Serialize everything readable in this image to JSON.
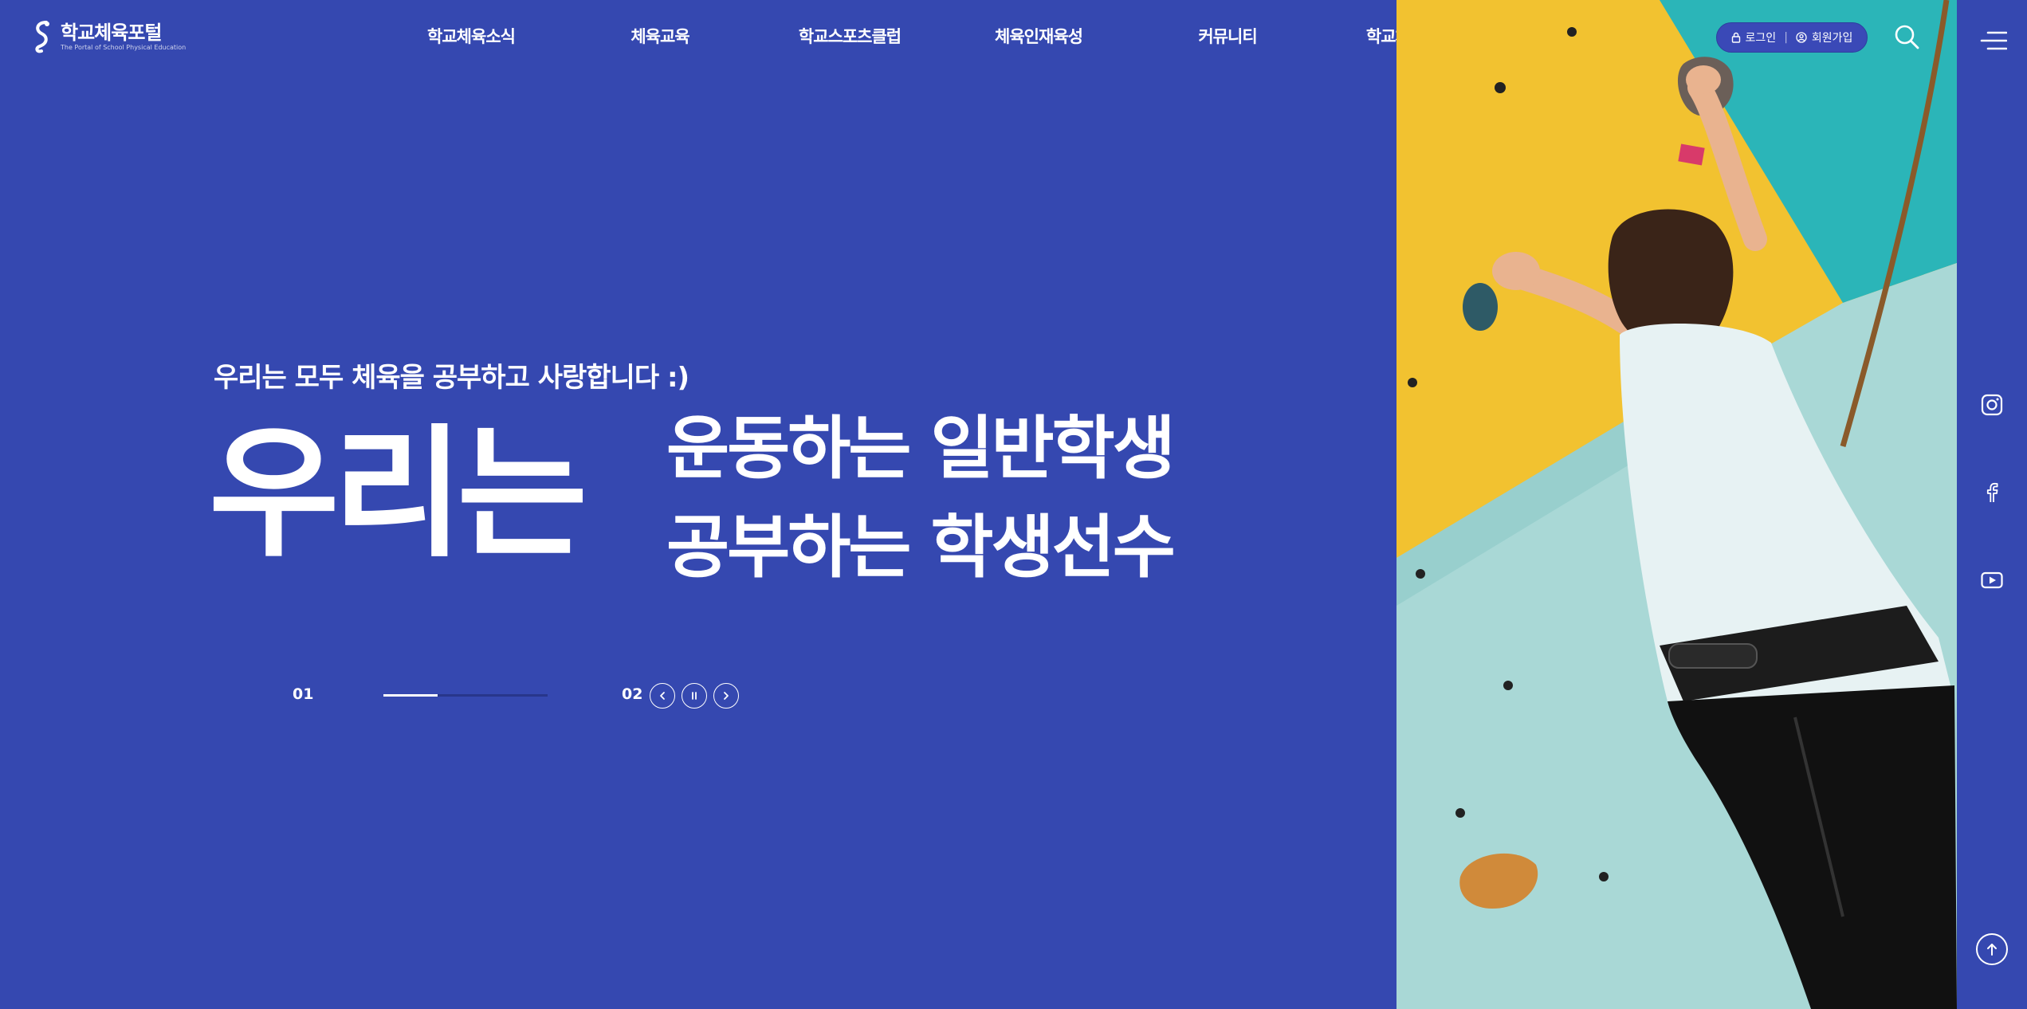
{
  "brand": {
    "title": "학교체육포털",
    "subtitle": "The Portal of School Physical Education"
  },
  "nav": {
    "items": [
      {
        "label": "학교체육소식"
      },
      {
        "label": "체육교육"
      },
      {
        "label": "학교스포츠클럽"
      },
      {
        "label": "체육인재육성"
      },
      {
        "label": "커뮤니티"
      },
      {
        "label": "학교체육진흥회"
      }
    ]
  },
  "auth": {
    "login_label": "로그인",
    "signup_label": "회원가입",
    "separator": "|"
  },
  "icons": {
    "search": "search-icon",
    "menu": "hamburger-menu-icon",
    "instagram": "instagram-icon",
    "facebook": "facebook-icon",
    "youtube": "youtube-icon",
    "top": "arrow-up-icon"
  },
  "hero": {
    "tagline": "우리는 모두 체육을 공부하고 사랑합니다 :)",
    "big_word": "우리는",
    "line1": "운동하는 일반학생",
    "line2": "공부하는 학생선수"
  },
  "slider": {
    "current": "01",
    "total": "02",
    "progress": 0.33
  },
  "colors": {
    "background": "#3548b0",
    "text": "#ffffff",
    "wall_yellow": "#f2c230",
    "wall_teal": "#2bb5b8",
    "wall_light": "#9fd6d4"
  }
}
